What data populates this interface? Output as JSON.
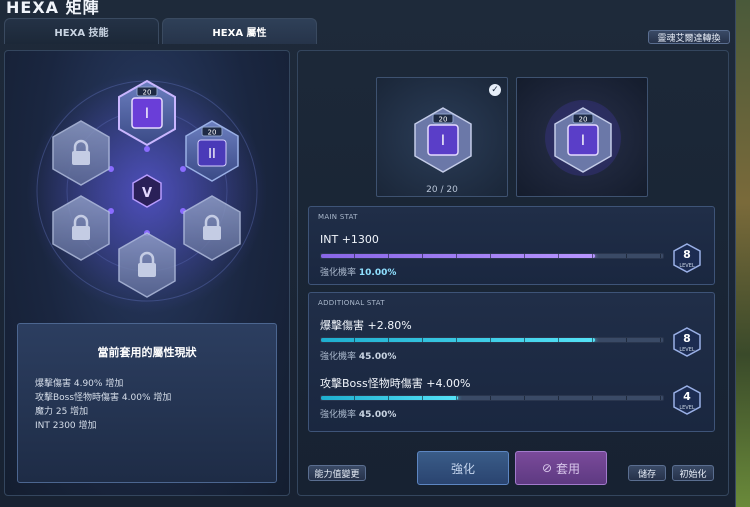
{
  "window": {
    "title": "HEXA 矩陣"
  },
  "tabs": [
    {
      "label": "HEXA 技能",
      "active": false
    },
    {
      "label": "HEXA 屬性",
      "active": true
    }
  ],
  "top_button": {
    "label": "靈魂艾爾達轉換"
  },
  "hexa_grid": {
    "active_badge": "20",
    "second_badge": "20",
    "center_symbol": "V"
  },
  "status_panel": {
    "title": "當前套用的屬性現狀",
    "lines": [
      "爆擊傷害 4.90% 增加",
      "攻擊Boss怪物時傷害 4.00% 增加",
      "魔力 25 增加",
      "INT 2300 增加"
    ]
  },
  "slots": [
    {
      "badge": "20",
      "count_text": "20 / 20",
      "selected": true
    },
    {
      "badge": "20",
      "selected": false
    }
  ],
  "main_stat": {
    "header": "MAIN STAT",
    "name": "INT +1300",
    "chance_label": "強化機率",
    "chance_value": "10.00%",
    "level": "8",
    "level_label": "LEVEL",
    "progress": 0.8
  },
  "additional_stat": {
    "header": "ADDITIONAL STAT",
    "items": [
      {
        "name": "爆擊傷害 +2.80%",
        "chance_label": "強化機率",
        "chance_value": "45.00%",
        "level": "8",
        "level_label": "LEVEL",
        "progress": 0.8
      },
      {
        "name": "攻擊Boss怪物時傷害 +4.00%",
        "chance_label": "強化機率",
        "chance_value": "45.00%",
        "level": "4",
        "level_label": "LEVEL",
        "progress": 0.4
      }
    ]
  },
  "buttons": {
    "stat_change": "能力值變更",
    "enhance": "強化",
    "apply": "套用",
    "save": "儲存",
    "reset": "初始化"
  },
  "colors": {
    "main_bar": "#b896ff",
    "additional_bar": "#55e2f7",
    "chance_main": "#8fe0ff",
    "chance_add": "#c9d4e2"
  }
}
